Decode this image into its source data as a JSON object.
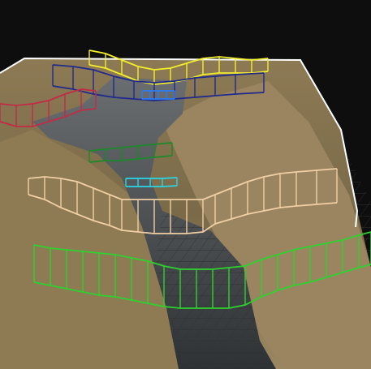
{
  "viewer": {
    "background": "#0e0e0e",
    "grid_color": "#2f2f2f",
    "bounding_box_color": "#ffffff"
  },
  "terrain": {
    "grass_dark": "#6b5a3c",
    "grass_light": "#a58f66",
    "water": "#3a3e42"
  },
  "cross_sections": [
    {
      "name": "section-yellow",
      "color": "#f2ee2a"
    },
    {
      "name": "section-navy",
      "color": "#1f2a8c"
    },
    {
      "name": "section-blue",
      "color": "#2b7bf0"
    },
    {
      "name": "section-red",
      "color": "#c22b45"
    },
    {
      "name": "section-darkgreen",
      "color": "#1a8a2a"
    },
    {
      "name": "section-cyan",
      "color": "#27d6e6"
    },
    {
      "name": "section-tan",
      "color": "#f1cfa4"
    },
    {
      "name": "section-green",
      "color": "#2ed22e"
    }
  ]
}
